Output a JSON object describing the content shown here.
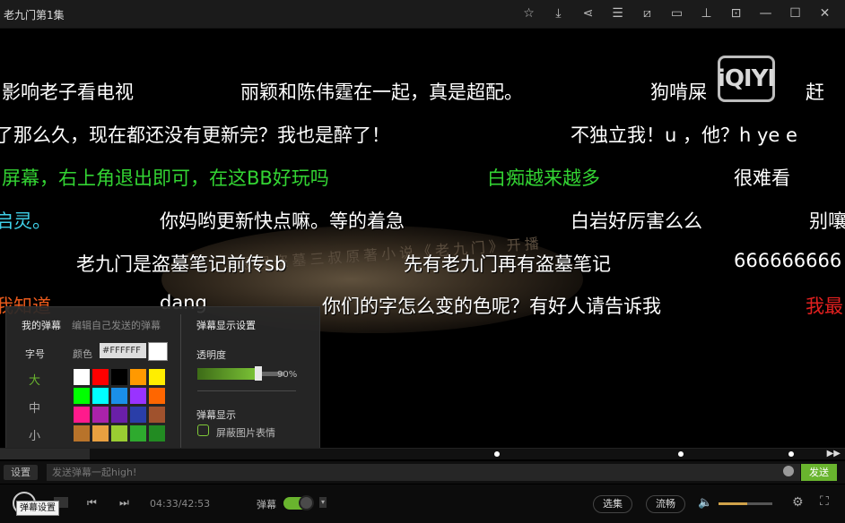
{
  "window": {
    "title": "老九门第1集",
    "icons": [
      "star-icon",
      "download-icon",
      "share-icon",
      "list-icon",
      "crop-icon",
      "chat-icon",
      "pin-icon",
      "mini-mode-icon",
      "minimize-icon",
      "maximize-icon",
      "close-icon"
    ]
  },
  "video": {
    "logo": "iQIYI",
    "scene_text": "最强盗墓三叔原著小说《老九门》开播"
  },
  "danmaku": [
    {
      "text": "影响老子看电视",
      "color": "#ffffff"
    },
    {
      "text": "丽颖和陈伟霆在一起，真是超配。",
      "color": "#ffffff"
    },
    {
      "text": "狗啃屎",
      "color": "#ffffff"
    },
    {
      "text": "赶",
      "color": "#ffffff"
    },
    {
      "text": "了那么久，现在都还没有更新完？我也是醉了！",
      "color": "#ffffff"
    },
    {
      "text": "不独立我！u ，他？h ye e",
      "color": "#ffffff"
    },
    {
      "text": "屏幕，右上角退出即可，在这BB好玩吗",
      "color": "#33d433"
    },
    {
      "text": "白痴越来越多",
      "color": "#33d433"
    },
    {
      "text": "很难看",
      "color": "#ffffff"
    },
    {
      "text": "启灵。",
      "color": "#3fd0e8"
    },
    {
      "text": "你妈哟更新快点嘛。等的着急",
      "color": "#ffffff"
    },
    {
      "text": "白岩好厉害么么",
      "color": "#ffffff"
    },
    {
      "text": "别嚷",
      "color": "#ffffff"
    },
    {
      "text": "老九门是盗墓笔记前传sb",
      "color": "#ffffff"
    },
    {
      "text": "先有老九门再有盗墓笔记",
      "color": "#ffffff"
    },
    {
      "text": "666666666",
      "color": "#ffffff"
    },
    {
      "text": "我知道",
      "color": "#e85a1c"
    },
    {
      "text": "dang",
      "color": "#ffffff"
    },
    {
      "text": "你们的字怎么变的色呢？有好人请告诉我",
      "color": "#ffffff"
    },
    {
      "text": "我最",
      "color": "#e0201f"
    }
  ],
  "settings_panel": {
    "tab_mine": "我的弹幕",
    "tab_edit": "编辑自己发送的弹幕",
    "display_title": "弹幕显示设置",
    "font_size_label": "字号",
    "sizes": [
      "大",
      "中",
      "小"
    ],
    "selected_size": "大",
    "color_label": "颜色",
    "color_value": "#FFFFFF",
    "swatches": [
      "#ffffff",
      "#ff0000",
      "#000000",
      "#ff9900",
      "#ffee00",
      "#00ff00",
      "#00ffff",
      "#1a8fe8",
      "#9933ff",
      "#ff6600",
      "#ff1a8c",
      "#aa22aa",
      "#6a1fa8",
      "#2a3ea8",
      "#a0522d",
      "#b8732a",
      "#e8a040",
      "#9acd32",
      "#2eaa2e",
      "#228b22"
    ],
    "opacity_label": "透明度",
    "opacity_value": "90%",
    "opacity": 0.9,
    "display_label": "弹幕显示",
    "hide_images_label": "屏蔽图片表情",
    "hide_images_checked": false
  },
  "input_bar": {
    "settings_label": "设置",
    "placeholder": "发送弹幕一起high!",
    "send_label": "发送"
  },
  "controls": {
    "time": "04:33/42:53",
    "danmaku_label": "弹幕",
    "danmaku_on": true,
    "episodes_label": "选集",
    "quality_label": "流畅",
    "volume_level": 0.53,
    "tooltip": "弹幕设置"
  },
  "progress": {
    "fraction": 0.106
  }
}
